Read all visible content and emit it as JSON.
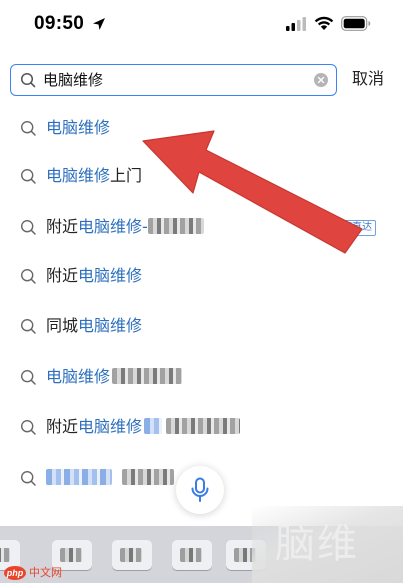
{
  "status_bar": {
    "time": "09:50",
    "icons": [
      "location-arrow-icon",
      "signal-icon",
      "wifi-icon",
      "battery-icon"
    ]
  },
  "search": {
    "query": "电脑维修",
    "cancel_label": "取消"
  },
  "suggestions": [
    {
      "highlight": "电脑维修",
      "suffix": ""
    },
    {
      "highlight": "电脑维修",
      "suffix": "上门"
    },
    {
      "prefix": "附近",
      "highlight": "电脑维修",
      "suffix": "-",
      "tag": "小程序直达"
    },
    {
      "prefix": "附近",
      "highlight": "电脑维修",
      "suffix": ""
    },
    {
      "prefix": "同城",
      "highlight": "电脑维修",
      "suffix": ""
    },
    {
      "highlight": "电脑维修",
      "suffix": ""
    },
    {
      "prefix": "附近",
      "highlight": "电脑维修",
      "suffix": ""
    },
    {
      "highlight": "",
      "suffix": ""
    }
  ],
  "voice": {
    "icon": "microphone-icon"
  },
  "annotation": {
    "color": "#e0443e"
  },
  "watermark": {
    "logo_text": "php",
    "label": "中文网",
    "corner_text": "脑维"
  },
  "colors": {
    "accent": "#3b82f6",
    "highlight_text": "#2d6fbe",
    "arrow": "#e0443e"
  }
}
